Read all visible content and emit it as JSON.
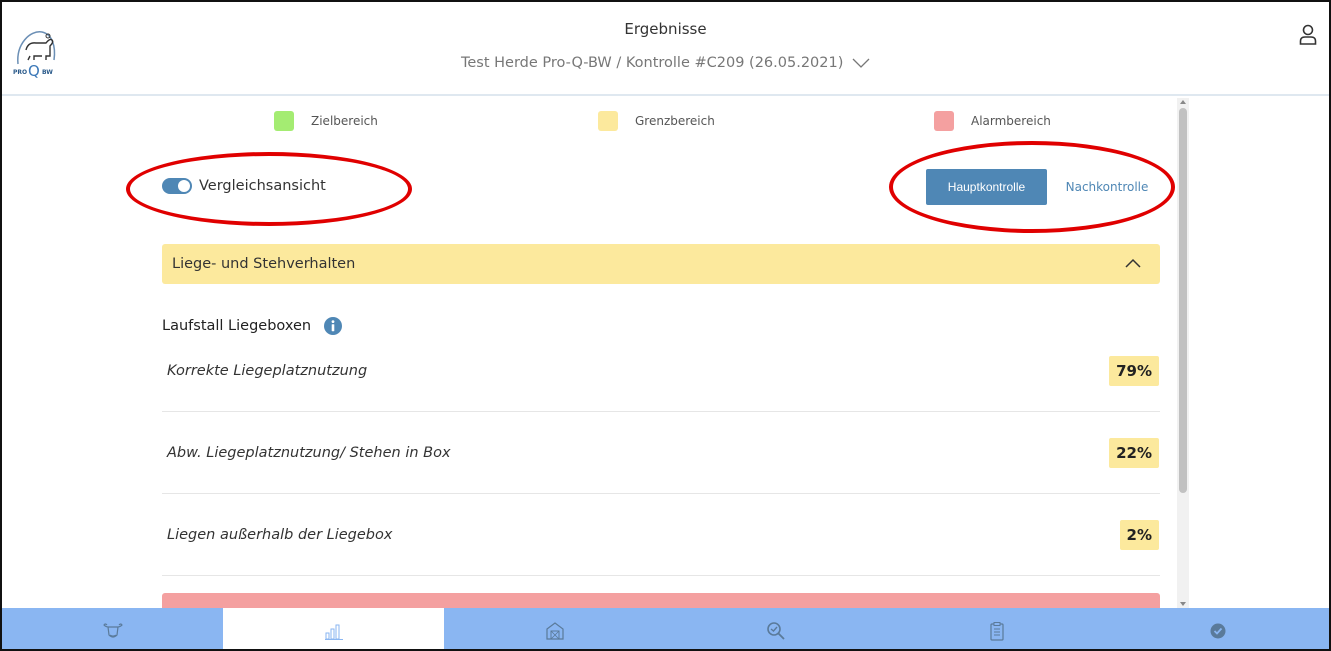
{
  "header": {
    "title": "Ergebnisse",
    "subtitle": "Test Herde Pro-Q-BW / Kontrolle #C209 (26.05.2021)",
    "logo": {
      "top": "PRO",
      "letter": "Q",
      "suffix": "BW"
    }
  },
  "legend": [
    {
      "label": "Zielbereich",
      "color": "#a4ec72"
    },
    {
      "label": "Grenzbereich",
      "color": "#fce99d"
    },
    {
      "label": "Alarmbereich",
      "color": "#f4a0a0"
    }
  ],
  "toggle": {
    "label": "Vergleichsansicht",
    "on": true
  },
  "buttons": {
    "primary": "Hauptkontrolle",
    "secondary": "Nachkontrolle"
  },
  "section": {
    "title": "Liege- und Stehverhalten",
    "color": "#fce99d"
  },
  "group": {
    "title": "Laufstall Liegeboxen"
  },
  "rows": [
    {
      "label": "Korrekte Liegeplatznutzung",
      "value": "79%"
    },
    {
      "label": "Abw. Liegeplatznutzung/ Stehen in Box",
      "value": "22%"
    },
    {
      "label": "Liegen außerhalb der Liegebox",
      "value": "2%"
    }
  ],
  "nav": [
    {
      "icon": "cow-icon",
      "active": false
    },
    {
      "icon": "bar-chart-icon",
      "active": true
    },
    {
      "icon": "barn-icon",
      "active": false
    },
    {
      "icon": "search-check-icon",
      "active": false
    },
    {
      "icon": "clipboard-icon",
      "active": false
    },
    {
      "icon": "check-circle-icon",
      "active": false
    }
  ],
  "colors": {
    "accent": "#4f87b5",
    "nav_bg": "#8ab6f2",
    "highlight": "#e00000"
  }
}
